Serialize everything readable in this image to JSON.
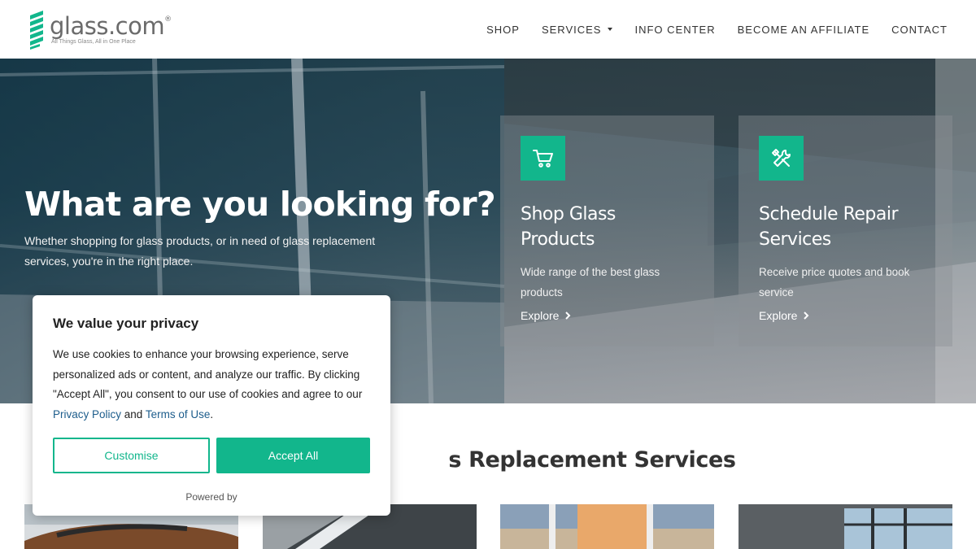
{
  "header": {
    "logo_word": "glass.com",
    "logo_reg": "®",
    "logo_tagline": "All Things Glass, All in One Place",
    "nav": [
      {
        "label": "SHOP"
      },
      {
        "label": "SERVICES"
      },
      {
        "label": "INFO CENTER"
      },
      {
        "label": "BECOME AN AFFILIATE"
      },
      {
        "label": "CONTACT"
      }
    ]
  },
  "hero": {
    "title": "What are you looking for?",
    "subtitle": "Whether shopping for glass products, or in need of glass replacement services, you're in the right place."
  },
  "cards": [
    {
      "icon": "cart-icon",
      "title": "Shop Glass Products",
      "desc": "Wide range of the best glass products",
      "link": "Explore"
    },
    {
      "icon": "tools-icon",
      "title": "Schedule Repair Services",
      "desc": "Receive price quotes and book service",
      "link": "Explore"
    }
  ],
  "section": {
    "title_visible": "s Replacement Services"
  },
  "cookie": {
    "title": "We value your privacy",
    "text_before": "We use cookies to enhance your browsing experience, serve personalized ads or content, and analyze our traffic. By clicking \"Accept All\", you consent to our use of cookies and agree to our ",
    "privacy_link": "Privacy Policy",
    "and": " and ",
    "terms_link": "Terms of Use",
    "period": ".",
    "customise_label": "Customise",
    "accept_label": "Accept All",
    "powered": "Powered by"
  },
  "colors": {
    "accent": "#12b68c",
    "link": "#1d5d8c"
  }
}
